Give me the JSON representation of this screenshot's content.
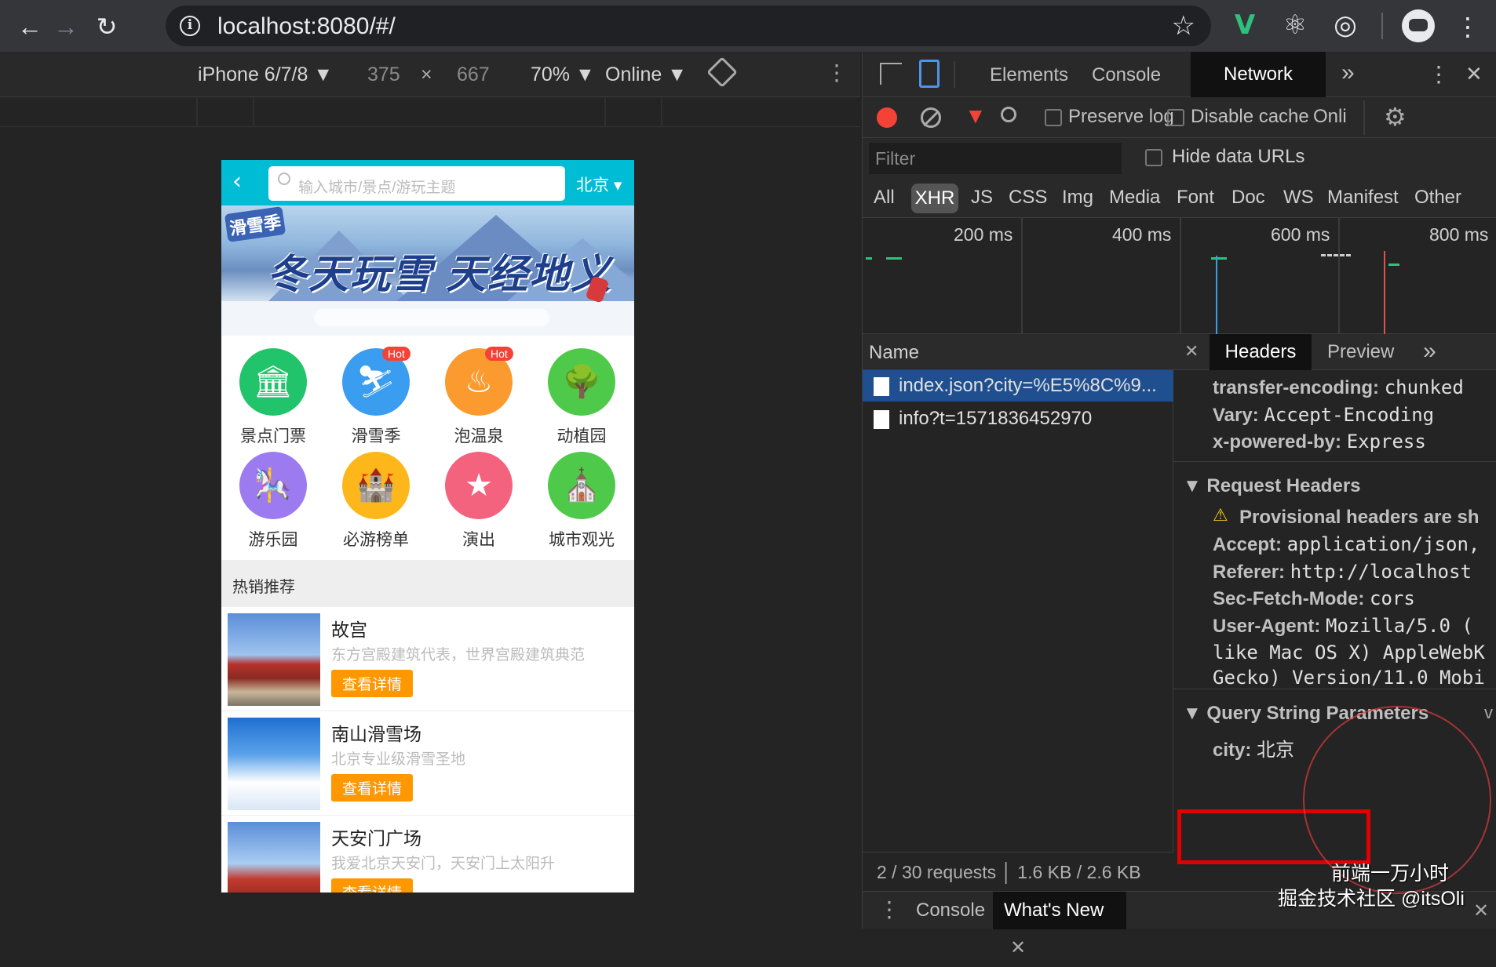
{
  "browser": {
    "url": "localhost:8080/#/",
    "back_icon": "←",
    "forward_icon": "→",
    "reload_icon": "↻",
    "star_icon": "☆",
    "menu_icon": "⋮"
  },
  "device_toolbar": {
    "device": "iPhone 6/7/8 ▼",
    "width": "375",
    "times": "×",
    "height": "667",
    "zoom": "70% ▼",
    "network": "Online ▼",
    "more": "⋮"
  },
  "phone": {
    "back": "‹",
    "search_placeholder": "输入城市/景点/游玩主题",
    "city": "北京 ▾",
    "banner_logo": "滑雪季",
    "banner_title": "冬天玩雪 天经地义",
    "categories": [
      {
        "label": "景点门票",
        "icon": "🏛",
        "color": "#21c36b",
        "hot": ""
      },
      {
        "label": "滑雪季",
        "icon": "⛷",
        "color": "#3a9df0",
        "hot": "Hot"
      },
      {
        "label": "泡温泉",
        "icon": "♨",
        "color": "#fb9a2e",
        "hot": "Hot"
      },
      {
        "label": "动植园",
        "icon": "🌳",
        "color": "#4fc94a",
        "hot": ""
      },
      {
        "label": "游乐园",
        "icon": "🎠",
        "color": "#9c7bf0",
        "hot": ""
      },
      {
        "label": "必游榜单",
        "icon": "🏰",
        "color": "#fdb71b",
        "hot": ""
      },
      {
        "label": "演出",
        "icon": "★",
        "color": "#f4637d",
        "hot": ""
      },
      {
        "label": "城市观光",
        "icon": "⛪",
        "color": "#4fc94a",
        "hot": ""
      }
    ],
    "hot_title": "热销推荐",
    "items": [
      {
        "title": "故宫",
        "desc": "东方宫殿建筑代表，世界宫殿建筑典范",
        "btn": "查看详情"
      },
      {
        "title": "南山滑雪场",
        "desc": "北京专业级滑雪圣地",
        "btn": "查看详情"
      },
      {
        "title": "天安门广场",
        "desc": "我爱北京天安门，天安门上太阳升",
        "btn": "查看详情"
      }
    ]
  },
  "devtools": {
    "tabs": [
      "Elements",
      "Console",
      "Network"
    ],
    "more_tabs": "»",
    "close": "✕",
    "kebab": "⋮",
    "toolbar": {
      "preserve_log": "Preserve log",
      "disable_cache": "Disable cache",
      "online": "Onli"
    },
    "filter_placeholder": "Filter",
    "hide_data_urls": "Hide data URLs",
    "types": [
      "All",
      "XHR",
      "JS",
      "CSS",
      "Img",
      "Media",
      "Font",
      "Doc",
      "WS",
      "Manifest",
      "Other"
    ],
    "timeline_labels": [
      "200 ms",
      "400 ms",
      "600 ms",
      "800 ms"
    ],
    "name_header": "Name",
    "requests": [
      "index.json?city=%E5%8C%9...",
      "info?t=1571836452970"
    ],
    "status": "2 / 30 requests  │  1.6 KB / 2.6 KB",
    "detail_tabs": {
      "close": "✕",
      "headers": "Headers",
      "preview": "Preview",
      "more": "»"
    },
    "response_headers": [
      {
        "k": "transfer-encoding:",
        "v": "chunked"
      },
      {
        "k": "Vary:",
        "v": "Accept-Encoding"
      },
      {
        "k": "x-powered-by:",
        "v": "Express"
      }
    ],
    "request_headers_title": "▼ Request Headers",
    "provisional": "Provisional headers are sh",
    "request_headers": [
      {
        "k": "Accept:",
        "v": "application/json,"
      },
      {
        "k": "Referer:",
        "v": "http://localhost"
      },
      {
        "k": "Sec-Fetch-Mode:",
        "v": "cors"
      },
      {
        "k": "User-Agent:",
        "v": "Mozilla/5.0 ("
      }
    ],
    "ua_cont_1": "like Mac OS X) AppleWebK",
    "ua_cont_2": "Gecko) Version/11.0 Mobi",
    "query_title": "▼ Query String Parameters",
    "query_view": "v",
    "query_params": [
      {
        "k": "city:",
        "v": "北京"
      }
    ],
    "drawer": {
      "kebab": "⋮",
      "console": "Console",
      "whats_new": "What's New",
      "close": "✕"
    }
  },
  "watermark": {
    "line1": "前端一万小时",
    "line2": "掘金技术社区 @itsOli"
  },
  "colors": {
    "accent_header": "#00bcd4",
    "button_orange": "#ff9800",
    "record_red": "#f44336",
    "highlight_red": "#e10000"
  }
}
